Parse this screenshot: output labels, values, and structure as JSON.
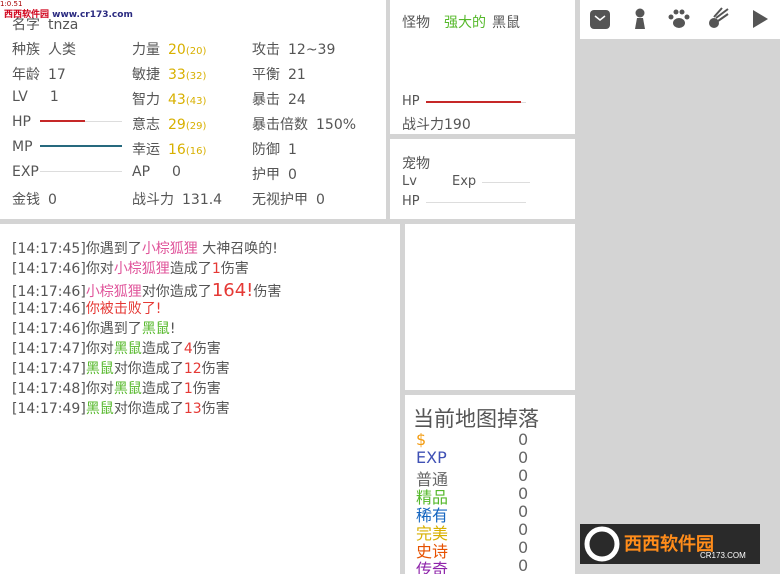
{
  "watermark": {
    "site_cn": "西西软件园",
    "site_url": "www.cr173.com",
    "tiny": "1:0.51",
    "logo_cn": "西西软件园",
    "logo_en": "CR173.COM"
  },
  "character": {
    "name_label": "名字",
    "name_value": "tnza",
    "race_label": "种族",
    "race_value": "人类",
    "age_label": "年龄",
    "age_value": "17",
    "lv_label": "LV",
    "lv_value": "1",
    "hp_label": "HP",
    "mp_label": "MP",
    "exp_label": "EXP",
    "gold_label": "金钱",
    "gold_value": "0",
    "str_label": "力量",
    "str_value": "20",
    "str_base": "(20)",
    "agi_label": "敏捷",
    "agi_value": "33",
    "agi_base": "(32)",
    "int_label": "智力",
    "int_value": "43",
    "int_base": "(43)",
    "will_label": "意志",
    "will_value": "29",
    "will_base": "(29)",
    "luck_label": "幸运",
    "luck_value": "16",
    "luck_base": "(16)",
    "ap_label": "AP",
    "ap_value": "0",
    "power_label": "战斗力",
    "power_value": "131.4",
    "atk_label": "攻击",
    "atk_value": "12~39",
    "bal_label": "平衡",
    "bal_value": "21",
    "crit_label": "暴击",
    "crit_value": "24",
    "critmult_label": "暴击倍数",
    "critmult_value": "150%",
    "def_label": "防御",
    "def_value": "1",
    "armor_label": "护甲",
    "armor_value": "0",
    "ignore_label": "无视护甲",
    "ignore_value": "0",
    "hp_fraction": 0.55,
    "mp_fraction": 1.0,
    "exp_fraction": 0.0,
    "hp_color": "#c62828",
    "mp_color": "#26697e"
  },
  "monster": {
    "label": "怪物",
    "prefix": "强大的",
    "name": "黑鼠",
    "hp_label": "HP",
    "hp_fraction": 0.95,
    "power_label": "战斗力",
    "power_value": "190",
    "prefix_color": "#55b82a"
  },
  "pet": {
    "title": "宠物",
    "lv_label": "Lv",
    "exp_label": "Exp",
    "hp_label": "HP"
  },
  "toolbar": {
    "icons": [
      "bag-icon",
      "person-icon",
      "paw-icon",
      "meteor-icon",
      "play-icon"
    ]
  },
  "log": [
    {
      "time": "[14:17:45]",
      "parts": [
        "你遇到了",
        "小棕狐狸",
        " 大神召唤的!"
      ]
    },
    {
      "time": "[14:17:46]",
      "parts": [
        "你对",
        "小棕狐狸",
        "造成了",
        "1",
        "伤害"
      ]
    },
    {
      "time": "[14:17:46]",
      "parts": [
        "小棕狐狸",
        "对你造成了",
        "164!",
        "伤害"
      ]
    },
    {
      "time": "[14:17:46]",
      "parts": [
        "你被击败了!"
      ]
    },
    {
      "time": "[14:17:46]",
      "parts": [
        "你遇到了",
        "黑鼠",
        "!"
      ]
    },
    {
      "time": "[14:17:47]",
      "parts": [
        "你对",
        "黑鼠",
        "造成了",
        "4",
        "伤害"
      ]
    },
    {
      "time": "[14:17:47]",
      "parts": [
        "黑鼠",
        "对你造成了",
        "12",
        "伤害"
      ]
    },
    {
      "time": "[14:17:48]",
      "parts": [
        "你对",
        "黑鼠",
        "造成了",
        "1",
        "伤害"
      ]
    },
    {
      "time": "[14:17:49]",
      "parts": [
        "黑鼠",
        "对你造成了",
        "13",
        "伤害"
      ]
    }
  ],
  "drops": {
    "title": "当前地图掉落",
    "rows": [
      {
        "label": "$",
        "count": "0",
        "color": "#f39c12"
      },
      {
        "label": "EXP",
        "count": "0",
        "color": "#3f51b5"
      },
      {
        "label": "普通",
        "count": "0",
        "color": "#666666"
      },
      {
        "label": "精品",
        "count": "0",
        "color": "#55b82a"
      },
      {
        "label": "稀有",
        "count": "0",
        "color": "#1565c0"
      },
      {
        "label": "完美",
        "count": "0",
        "color": "#d8b000"
      },
      {
        "label": "史诗",
        "count": "0",
        "color": "#e65100"
      },
      {
        "label": "传奇",
        "count": "0",
        "color": "#8e24aa"
      }
    ]
  }
}
